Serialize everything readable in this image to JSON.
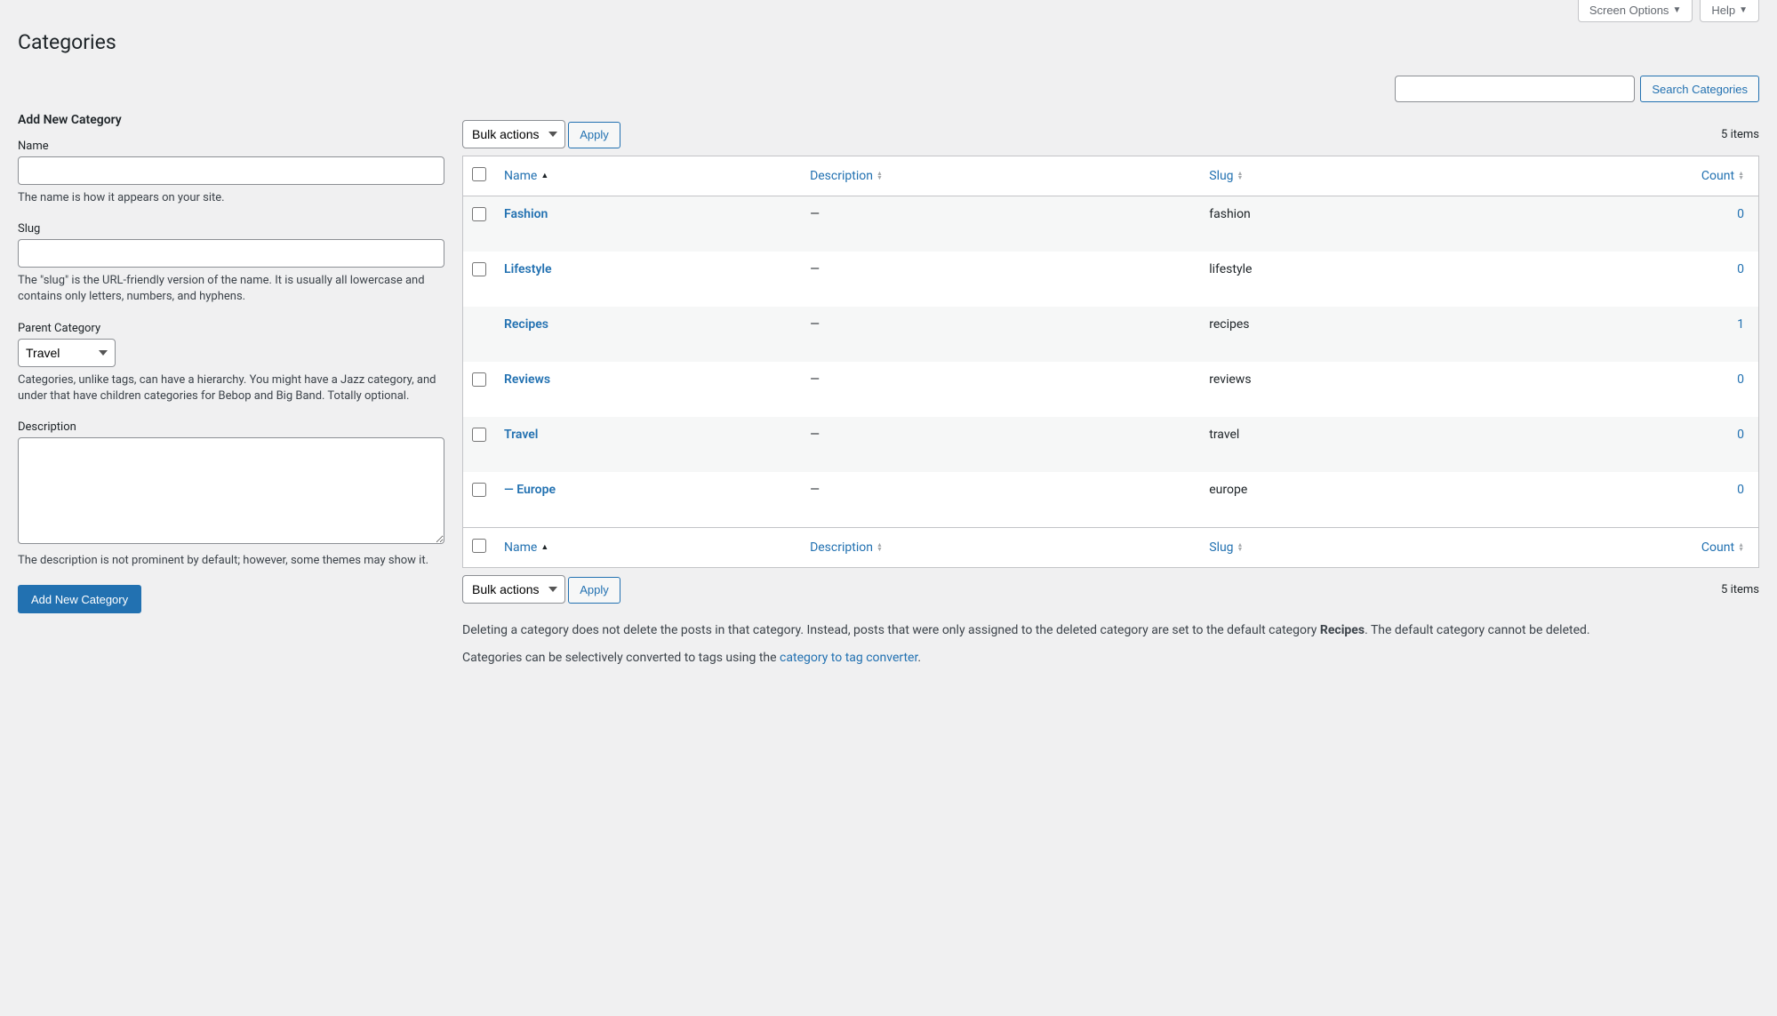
{
  "top": {
    "screen_options": "Screen Options",
    "help": "Help"
  },
  "page_title": "Categories",
  "search": {
    "button": "Search Categories"
  },
  "form": {
    "heading": "Add New Category",
    "name_label": "Name",
    "name_desc": "The name is how it appears on your site.",
    "slug_label": "Slug",
    "slug_desc": "The \"slug\" is the URL-friendly version of the name. It is usually all lowercase and contains only letters, numbers, and hyphens.",
    "parent_label": "Parent Category",
    "parent_value": "Travel",
    "parent_desc": "Categories, unlike tags, can have a hierarchy. You might have a Jazz category, and under that have children categories for Bebop and Big Band. Totally optional.",
    "description_label": "Description",
    "description_desc": "The description is not prominent by default; however, some themes may show it.",
    "submit_label": "Add New Category"
  },
  "list": {
    "bulk_label": "Bulk actions",
    "apply_label": "Apply",
    "items_count": "5 items"
  },
  "columns": {
    "name": "Name",
    "description": "Description",
    "slug": "Slug",
    "count": "Count"
  },
  "rows": [
    {
      "name": "Fashion",
      "desc": "—",
      "slug": "fashion",
      "count": "0",
      "indent": false
    },
    {
      "name": "Lifestyle",
      "desc": "—",
      "slug": "lifestyle",
      "count": "0",
      "indent": false
    },
    {
      "name": "Recipes",
      "desc": "—",
      "slug": "recipes",
      "count": "1",
      "indent": false,
      "nocheck": true
    },
    {
      "name": "Reviews",
      "desc": "—",
      "slug": "reviews",
      "count": "0",
      "indent": false
    },
    {
      "name": "Travel",
      "desc": "—",
      "slug": "travel",
      "count": "0",
      "indent": false
    },
    {
      "name": "— Europe",
      "desc": "—",
      "slug": "europe",
      "count": "0",
      "indent": false
    }
  ],
  "footer": {
    "note1a": "Deleting a category does not delete the posts in that category. Instead, posts that were only assigned to the deleted category are set to the default category ",
    "note1_strong": "Recipes",
    "note1b": ". The default category cannot be deleted.",
    "note2a": "Categories can be selectively converted to tags using the ",
    "note2_link": "category to tag converter",
    "note2b": "."
  }
}
